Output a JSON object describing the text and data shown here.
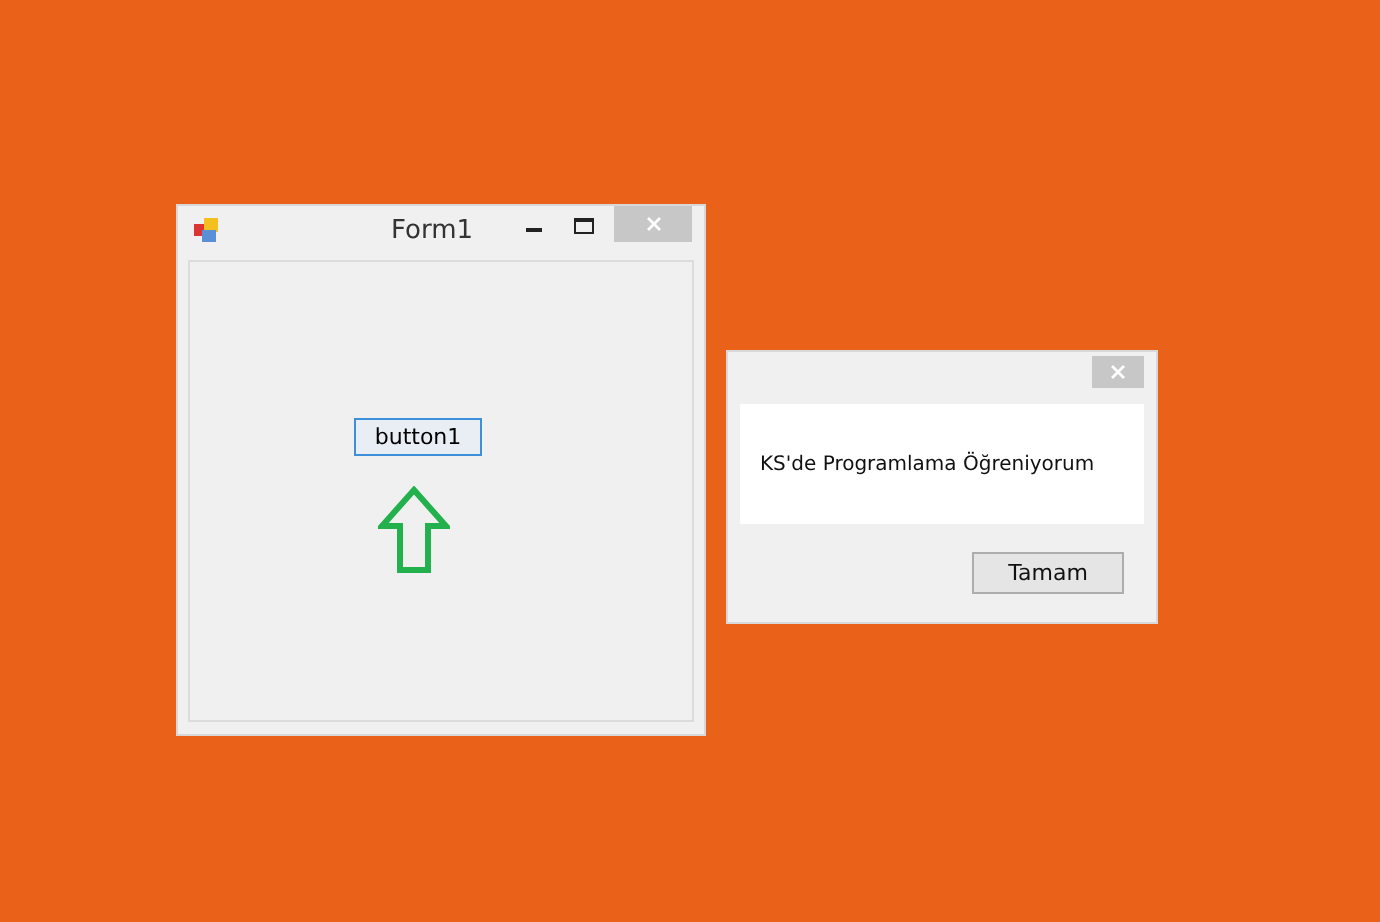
{
  "form_window": {
    "title": "Form1",
    "button": "button1"
  },
  "message_box": {
    "message": "KS'de Programlama Öğreniyorum",
    "button": "Tamam"
  }
}
